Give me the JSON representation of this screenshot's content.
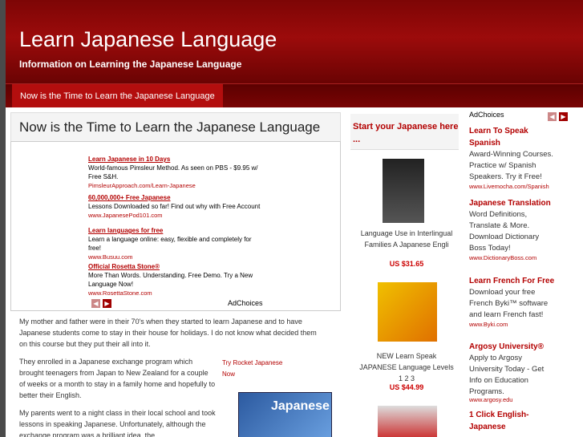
{
  "header": {
    "title": "Learn Japanese Language",
    "description": "Information on Learning the Japanese Language"
  },
  "nav": {
    "item": "Now is the Time to Learn the Japanese Language"
  },
  "post": {
    "title": "Now is the Time to Learn the Japanese Language",
    "paragraphs": [
      "My mother and father were in their 70's when they started to learn Japanese and to have Japanese students come to stay in their house for holidays. I do not know what decided them on this course but they put their all into it.",
      "They enrolled in a Japanese exchange program which brought teenagers from Japan to New Zealand for a couple of weeks or a month to stay in a family home and hopefully to better their English.",
      "My parents went to a night class in their local school and took lessons in speaking Japanese.  Unfortunately, although the exchange program was a brilliant idea, the"
    ],
    "rocket_link": "Try Rocket Japanese Now",
    "rocket_image_text": "Japanese"
  },
  "content_ads": [
    {
      "title": "Learn Japanese in 10 Days",
      "body": "World-famous Pimsleur Method. As seen on PBS - $9.95 w/ Free S&H.",
      "url": "PimsleurApproach.com/Learn-Japanese"
    },
    {
      "title": "60,000,000+ Free Japanese",
      "body": "Lessons Downloaded so far! Find out why with Free Account",
      "url": "www.JapanesePod101.com"
    },
    {
      "title": "Learn languages for free",
      "body": "Learn a language online: easy, flexible and completely for free!",
      "url": "www.Busuu.com"
    },
    {
      "title": "Official Rosetta Stone®",
      "body": "More Than Words. Understanding. Free Demo. Try a New Language Now!",
      "url": "www.RosettaStone.com"
    }
  ],
  "adchoices_label": "AdChoices",
  "arrows": {
    "prev": "◀",
    "next": "▶"
  },
  "middle": {
    "heading": "Start your Japanese here ...",
    "books": [
      {
        "title": "Language Use in Interlingual Families A Japanese Engli",
        "price": "US $31.65"
      },
      {
        "title": "NEW Learn Speak JAPANESE Language Levels 1 2 3",
        "price": "US $44.99"
      }
    ]
  },
  "right_ads": [
    {
      "title": "Learn To Speak Spanish",
      "body": "Award-Winning Courses. Practice w/ Spanish Speakers. Try it Free!",
      "url": "www.Livemocha.com/Spanish"
    },
    {
      "title": "Japanese Translation",
      "body": "Word Definitions, Translate & More. Download Dictionary Boss Today!",
      "url": "www.DictionaryBoss.com"
    },
    {
      "title": "Learn French For Free",
      "body": "Download your free French Byki™ software and learn French fast!",
      "url": "www.Byki.com"
    },
    {
      "title": "Argosy University®",
      "body": "Apply to Argosy University Today - Get Info on Education Programs.",
      "url": "www.argosy.edu"
    },
    {
      "title": "1 Click English-Japanese",
      "body": "",
      "url": ""
    }
  ]
}
